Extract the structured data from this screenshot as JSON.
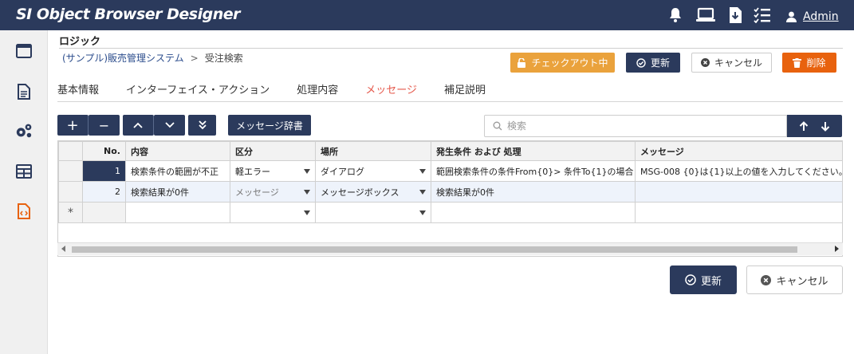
{
  "app": {
    "title": "SI Object Browser Designer"
  },
  "header": {
    "user_name": "Admin"
  },
  "page": {
    "title": "ロジック"
  },
  "breadcrumb": {
    "parent": "(サンプル)販売管理システム",
    "separator": ">",
    "current": "受注検索"
  },
  "actions": {
    "checkout": "チェックアウト中",
    "update": "更新",
    "cancel": "キャンセル",
    "delete": "削除"
  },
  "tabs": [
    {
      "label": "基本情報"
    },
    {
      "label": "インターフェイス・アクション"
    },
    {
      "label": "処理内容"
    },
    {
      "label": "メッセージ"
    },
    {
      "label": "補足説明"
    }
  ],
  "active_tab": "メッセージ",
  "toolbar": {
    "add": "+",
    "remove": "−",
    "message_dict": "メッセージ辞書"
  },
  "search": {
    "placeholder": "検索",
    "value": ""
  },
  "grid": {
    "columns": [
      "",
      "No.",
      "内容",
      "区分",
      "場所",
      "発生条件 および 処理",
      "メッセージ"
    ],
    "rows": [
      {
        "no": "1",
        "content": "検索条件の範囲が不正",
        "category": "軽エラー",
        "location": "ダイアログ",
        "condition": "範囲検索条件の条件From{0}> 条件To{1}の場合",
        "message": "MSG-008 {0}は{1}以上の値を入力してください。"
      },
      {
        "no": "2",
        "content": "検索結果が0件",
        "category": "メッセージ",
        "location": "メッセージボックス",
        "condition": "検索結果が0件",
        "message": ""
      }
    ],
    "new_row_marker": "*"
  },
  "footer": {
    "update": "更新",
    "cancel": "キャンセル"
  },
  "colors": {
    "navy": "#2b3a5c",
    "orange": "#eaa23c",
    "delete": "#e8620e",
    "active_tab": "#e5584b"
  }
}
